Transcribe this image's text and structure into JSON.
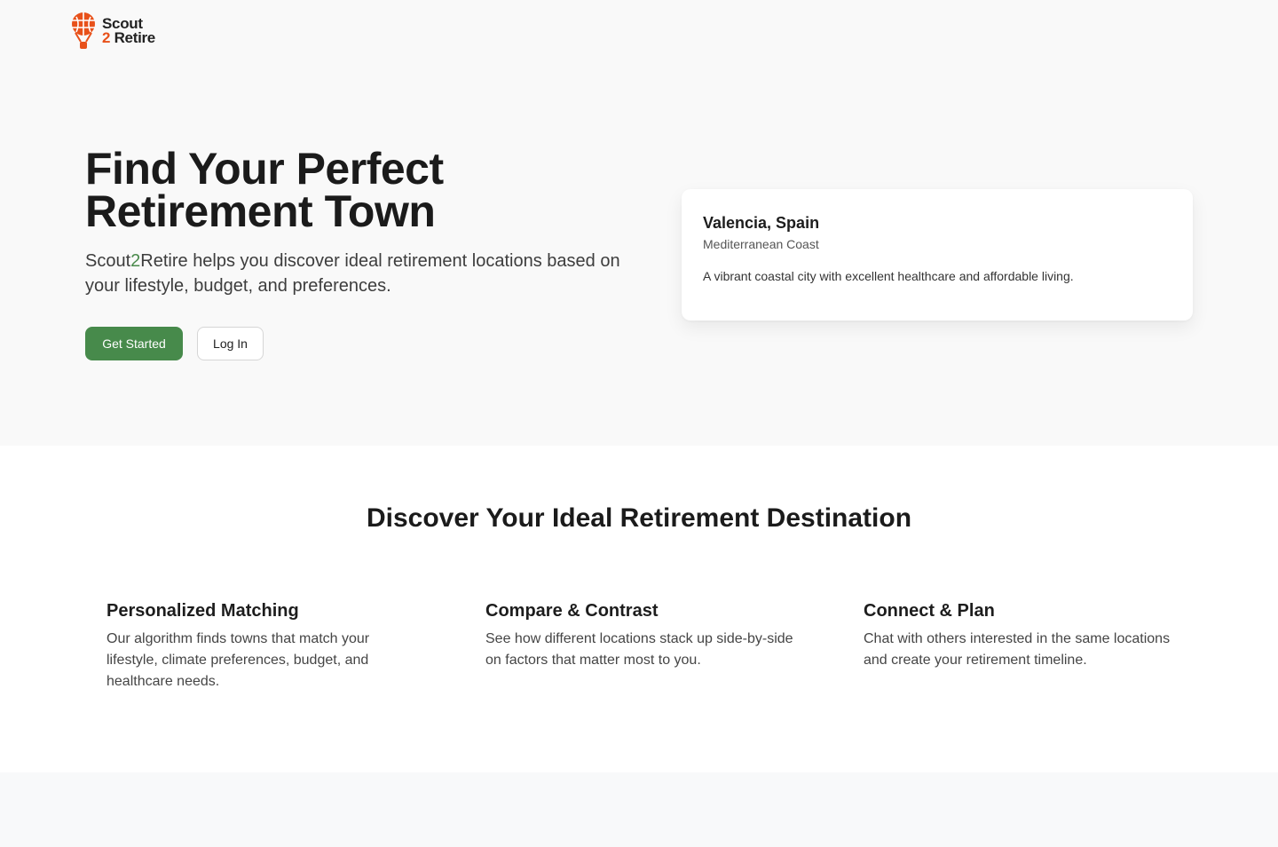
{
  "brand": {
    "line1": "Scout",
    "line2_accent": "2",
    "line2_rest": " Retire",
    "icon": "hot-air-balloon-icon",
    "accent_color": "#e8511a"
  },
  "hero": {
    "title": "Find Your Perfect Retirement Town",
    "subtitle_start": "Scout",
    "subtitle_two": "2",
    "subtitle_rest": "Retire helps you discover ideal retirement locations based on your lifestyle, budget, and preferences.",
    "primary_button": "Get Started",
    "secondary_button": "Log In",
    "primary_color": "#478a4b"
  },
  "card": {
    "title": "Valencia, Spain",
    "region": "Mediterranean Coast",
    "description": "A vibrant coastal city with excellent healthcare and affordable living."
  },
  "features": {
    "title": "Discover Your Ideal Retirement Destination",
    "items": [
      {
        "title": "Personalized Matching",
        "description": "Our algorithm finds towns that match your lifestyle, climate preferences, budget, and healthcare needs."
      },
      {
        "title": "Compare & Contrast",
        "description": "See how different locations stack up side-by-side on factors that matter most to you."
      },
      {
        "title": "Connect & Plan",
        "description": "Chat with others interested in the same locations and create your retirement timeline."
      }
    ]
  }
}
